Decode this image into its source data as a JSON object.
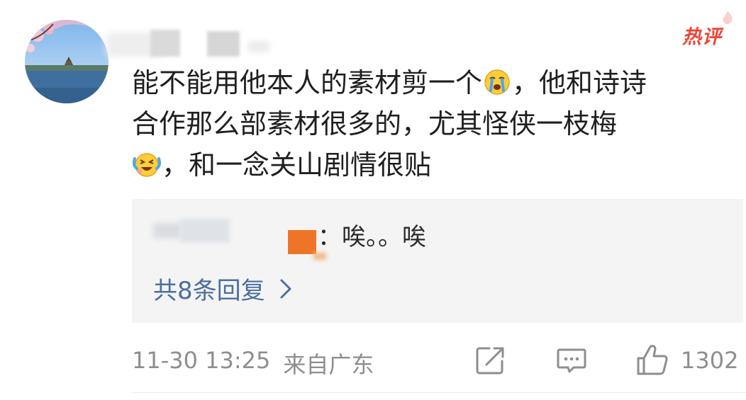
{
  "comment": {
    "badge": "热评",
    "lines": [
      {
        "before": "能不能用他本人的素材剪一个",
        "emoji": "crying-face",
        "after": "，他和诗诗"
      },
      {
        "text": "合作那么部素材很多的，尤其怪侠一枝梅"
      },
      {
        "emoji": "laugh-cry-face",
        "after": "，和一念关山剧情很贴"
      }
    ]
  },
  "reply": {
    "text": "：唉。。唉",
    "more_label": "共8条回复"
  },
  "footer": {
    "date": "11-30 13:25",
    "location": "来自广东",
    "like_count": "1302"
  },
  "colors": {
    "hot_badge": "#ee4435",
    "link": "#4b6ea0",
    "meta": "#8e8e8e",
    "reply_bg": "#f4f4f4"
  }
}
